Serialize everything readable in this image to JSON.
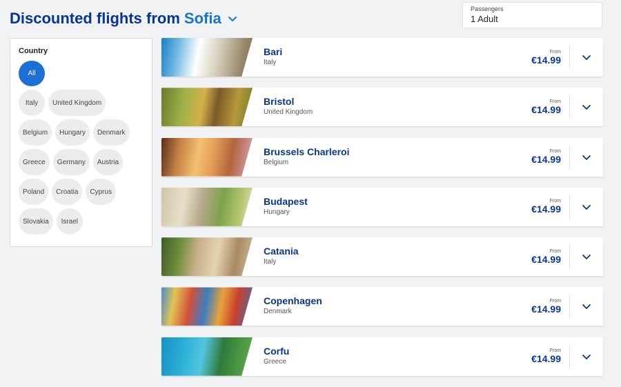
{
  "header": {
    "title_prefix": "Discounted flights from",
    "origin_city": "Sofia"
  },
  "passengers": {
    "label": "Passengers",
    "value": "1 Adult"
  },
  "filter": {
    "heading": "Country",
    "chips": [
      "All",
      "Italy",
      "United Kingdom",
      "Belgium",
      "Hungary",
      "Denmark",
      "Greece",
      "Germany",
      "Austria",
      "Poland",
      "Croatia",
      "Cyprus",
      "Slovakia",
      "Israel"
    ],
    "selected": "All"
  },
  "flights": [
    {
      "city": "Bari",
      "country": "Italy",
      "from_label": "From",
      "price": "€14.99"
    },
    {
      "city": "Bristol",
      "country": "United Kingdom",
      "from_label": "From",
      "price": "€14.99"
    },
    {
      "city": "Brussels Charleroi",
      "country": "Belgium",
      "from_label": "From",
      "price": "€14.99"
    },
    {
      "city": "Budapest",
      "country": "Hungary",
      "from_label": "From",
      "price": "€14.99"
    },
    {
      "city": "Catania",
      "country": "Italy",
      "from_label": "From",
      "price": "€14.99"
    },
    {
      "city": "Copenhagen",
      "country": "Denmark",
      "from_label": "From",
      "price": "€14.99"
    },
    {
      "city": "Corfu",
      "country": "Greece",
      "from_label": "From",
      "price": "€14.99"
    }
  ],
  "colors": {
    "brand_navy": "#073590",
    "brand_blue": "#1a73c8",
    "chip_active": "#1d6fd6",
    "chip_bg": "#ececec",
    "page_bg": "#f1f2f3"
  },
  "icons": {
    "origin_dropdown": "chevron-down-icon",
    "card_expand": "chevron-down-icon"
  }
}
